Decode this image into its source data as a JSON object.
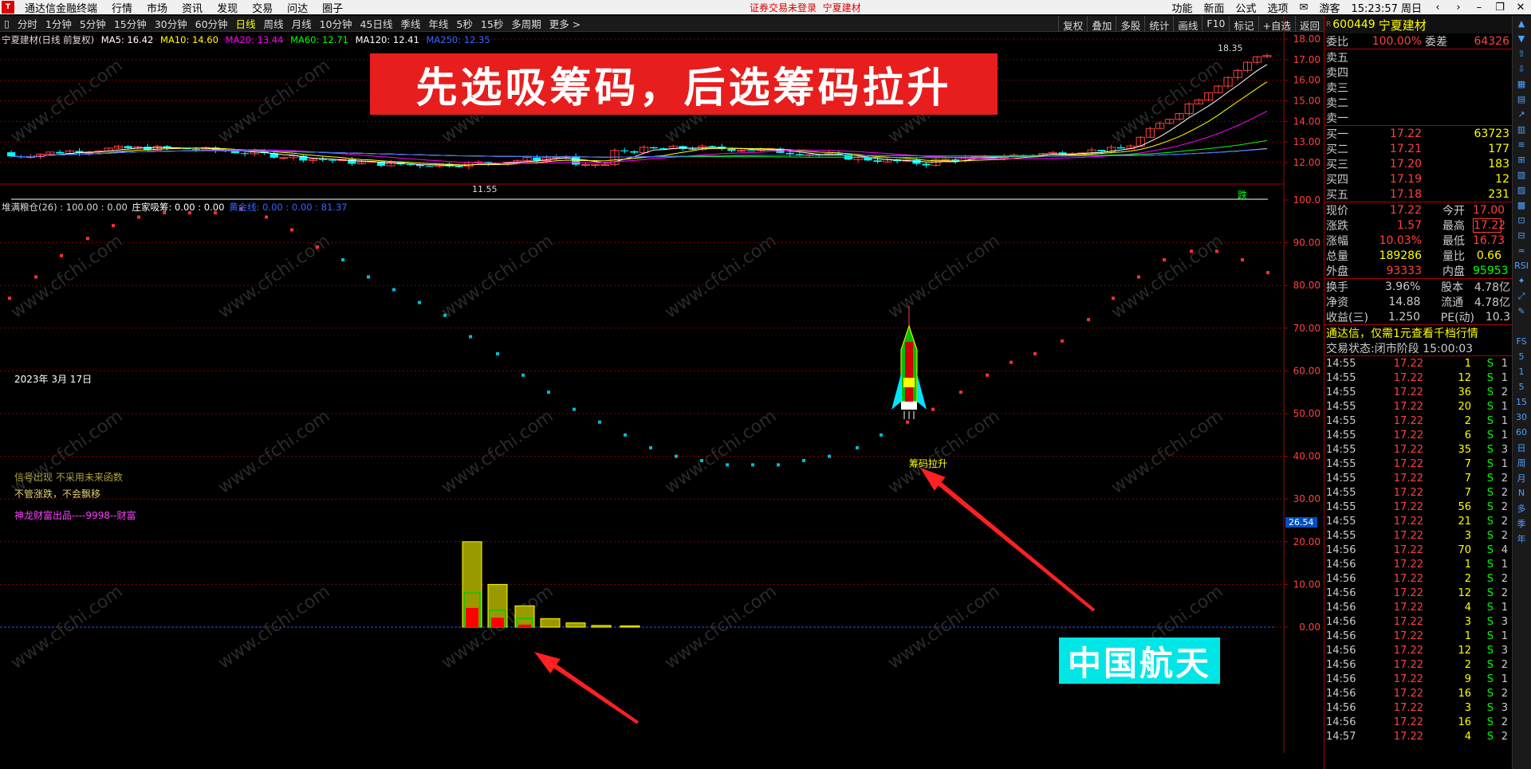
{
  "menubar": {
    "app_title": "通达信金融终端",
    "items": [
      "行情",
      "市场",
      "资讯",
      "发现",
      "交易",
      "问达",
      "圈子"
    ],
    "notice": "证券交易未登录",
    "stock_short": "宁夏建材",
    "right_items": [
      "功能",
      "新面",
      "公式",
      "选项"
    ],
    "user": "游客",
    "time": "15:23:57 周日"
  },
  "toolbar": {
    "periods": [
      "分时",
      "1分钟",
      "5分钟",
      "15分钟",
      "30分钟",
      "60分钟",
      "日线",
      "周线",
      "月线",
      "10分钟",
      "45日线",
      "季线",
      "年线",
      "5秒",
      "15秒",
      "多周期",
      "更多 >"
    ],
    "active": "日线",
    "right": [
      "复权",
      "叠加",
      "多股",
      "统计",
      "画线",
      "F10",
      "标记",
      "+自选",
      "返回"
    ]
  },
  "title_line": {
    "name": "宁夏建材(日线 前复权)",
    "ma5": "MA5: 16.42",
    "ma10": "MA10: 14.60",
    "ma20": "MA20: 13.44",
    "ma60": "MA60: 12.71",
    "ma120": "MA120: 12.41",
    "ma250": "MA250: 12.35"
  },
  "banner": "先选吸筹码，后选筹码拉升",
  "price_axis": [
    "18.00",
    "17.00",
    "16.00",
    "15.00",
    "14.00",
    "13.00",
    "12.00"
  ],
  "price_high_label": "18.35",
  "price_low_label": "11.55",
  "fall_label": "跌",
  "indicator_line": {
    "a": "堆满粮仓(26) : 100.00 : 0.00",
    "b": "庄家吸筹: 0.00 : 0.00",
    "c": "黄金线: 0.00 : 0.00 : 81.37"
  },
  "ind_axis": [
    "100.0",
    "90.00",
    "80.00",
    "70.00",
    "60.00",
    "50.00",
    "40.00",
    "30.00",
    "20.00",
    "10.00",
    "0.00"
  ],
  "current_marker": "26.54",
  "date_label": "2023年 3月 17日",
  "notes": {
    "n1": "信号出现  不采用未来函数",
    "n2": "不管涨跌，不会飘移",
    "n3": "神龙财富出品----9998--财富"
  },
  "rocket_label": "筹码拉升",
  "cyan_label": "中国航天",
  "watermark": "www.cfchi.com",
  "right_panel": {
    "code": "600449",
    "name": "宁夏建材",
    "weibi": "委比",
    "weibi_val": "100.00%",
    "weicha": "委差",
    "weicha_val": "64326",
    "sell": [
      [
        "卖五",
        "",
        ""
      ],
      [
        "卖四",
        "",
        ""
      ],
      [
        "卖三",
        "",
        ""
      ],
      [
        "卖二",
        "",
        ""
      ],
      [
        "卖一",
        "",
        ""
      ]
    ],
    "buy": [
      [
        "买一",
        "17.22",
        "63723"
      ],
      [
        "买二",
        "17.21",
        "177"
      ],
      [
        "买三",
        "17.20",
        "183"
      ],
      [
        "买四",
        "17.19",
        "12"
      ],
      [
        "买五",
        "17.18",
        "231"
      ]
    ],
    "quote": [
      [
        "现价",
        "17.22",
        "今开",
        "17.00"
      ],
      [
        "涨跌",
        "1.57",
        "最高",
        "17.22"
      ],
      [
        "涨幅",
        "10.03%",
        "最低",
        "16.73"
      ],
      [
        "总量",
        "189286",
        "量比",
        "0.66"
      ],
      [
        "外盘",
        "93333",
        "内盘",
        "95953"
      ]
    ],
    "fin": [
      [
        "换手",
        "3.96%",
        "股本",
        "4.78亿"
      ],
      [
        "净资",
        "14.88",
        "流通",
        "4.78亿"
      ],
      [
        "收益(三)",
        "1.250",
        "PE(动)",
        "10.3"
      ]
    ],
    "promo": "通达信，仅需1元查看千档行情",
    "status": "交易状态:闭市阶段 15:00:03",
    "ticks": [
      [
        "14:55",
        "17.22",
        "1",
        "S",
        "1"
      ],
      [
        "14:55",
        "17.22",
        "12",
        "S",
        "1"
      ],
      [
        "14:55",
        "17.22",
        "36",
        "S",
        "2"
      ],
      [
        "14:55",
        "17.22",
        "20",
        "S",
        "1"
      ],
      [
        "14:55",
        "17.22",
        "2",
        "S",
        "1"
      ],
      [
        "14:55",
        "17.22",
        "6",
        "S",
        "1"
      ],
      [
        "14:55",
        "17.22",
        "35",
        "S",
        "3"
      ],
      [
        "14:55",
        "17.22",
        "7",
        "S",
        "1"
      ],
      [
        "14:55",
        "17.22",
        "7",
        "S",
        "2"
      ],
      [
        "14:55",
        "17.22",
        "7",
        "S",
        "2"
      ],
      [
        "14:55",
        "17.22",
        "56",
        "S",
        "2"
      ],
      [
        "14:55",
        "17.22",
        "21",
        "S",
        "2"
      ],
      [
        "14:55",
        "17.22",
        "3",
        "S",
        "2"
      ],
      [
        "14:56",
        "17.22",
        "70",
        "S",
        "4"
      ],
      [
        "14:56",
        "17.22",
        "1",
        "S",
        "1"
      ],
      [
        "14:56",
        "17.22",
        "2",
        "S",
        "2"
      ],
      [
        "14:56",
        "17.22",
        "12",
        "S",
        "2"
      ],
      [
        "14:56",
        "17.22",
        "4",
        "S",
        "1"
      ],
      [
        "14:56",
        "17.22",
        "3",
        "S",
        "3"
      ],
      [
        "14:56",
        "17.22",
        "1",
        "S",
        "1"
      ],
      [
        "14:56",
        "17.22",
        "12",
        "S",
        "3"
      ],
      [
        "14:56",
        "17.22",
        "2",
        "S",
        "2"
      ],
      [
        "14:56",
        "17.22",
        "9",
        "S",
        "1"
      ],
      [
        "14:56",
        "17.22",
        "16",
        "S",
        "2"
      ],
      [
        "14:56",
        "17.22",
        "3",
        "S",
        "3"
      ],
      [
        "14:56",
        "17.22",
        "16",
        "S",
        "2"
      ],
      [
        "14:57",
        "17.22",
        "4",
        "S",
        "2"
      ]
    ]
  },
  "side_strip": [
    "▲",
    "▼",
    "⇧",
    "⇩",
    "▦",
    "▤",
    "↗",
    "▥",
    "≋",
    "⊞",
    "▧",
    "▨",
    "▩",
    "⊡",
    "⊟",
    "≈",
    "RSI",
    "✦",
    "⤢",
    "✎",
    "",
    "FS",
    "5",
    "1",
    "5",
    "15",
    "30",
    "60",
    "日",
    "周",
    "月",
    "N",
    "多",
    "季",
    "年"
  ],
  "colors": {
    "up": "#ff4040",
    "down": "#00ffff",
    "ma5": "#ffffff",
    "ma10": "#ffff00",
    "ma20": "#ff00ff",
    "ma60": "#00ff00",
    "ma120": "#ffffff",
    "ma250": "#3366ff"
  }
}
